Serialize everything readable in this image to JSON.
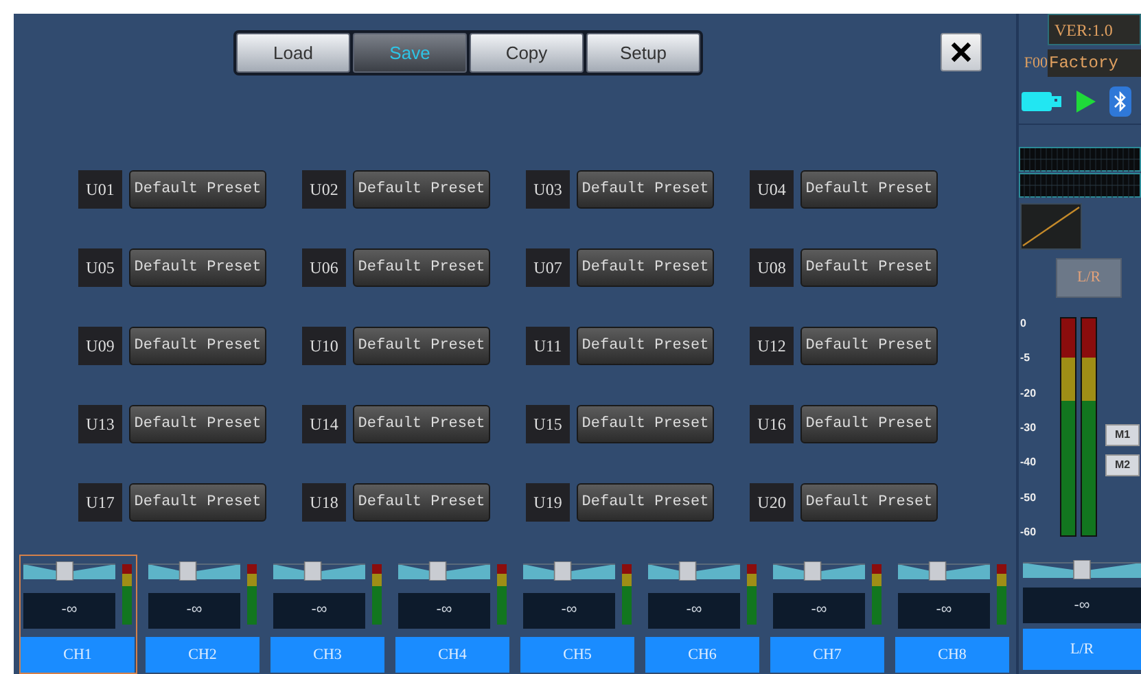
{
  "tabs": [
    {
      "label": "Load",
      "selected": false
    },
    {
      "label": "Save",
      "selected": true
    },
    {
      "label": "Copy",
      "selected": false
    },
    {
      "label": "Setup",
      "selected": false
    }
  ],
  "presets": [
    {
      "slot": "U01",
      "name": "Default Preset"
    },
    {
      "slot": "U02",
      "name": "Default Preset"
    },
    {
      "slot": "U03",
      "name": "Default Preset"
    },
    {
      "slot": "U04",
      "name": "Default Preset"
    },
    {
      "slot": "U05",
      "name": "Default Preset"
    },
    {
      "slot": "U06",
      "name": "Default Preset"
    },
    {
      "slot": "U07",
      "name": "Default Preset"
    },
    {
      "slot": "U08",
      "name": "Default Preset"
    },
    {
      "slot": "U09",
      "name": "Default Preset"
    },
    {
      "slot": "U10",
      "name": "Default Preset"
    },
    {
      "slot": "U11",
      "name": "Default Preset"
    },
    {
      "slot": "U12",
      "name": "Default Preset"
    },
    {
      "slot": "U13",
      "name": "Default Preset"
    },
    {
      "slot": "U14",
      "name": "Default Preset"
    },
    {
      "slot": "U15",
      "name": "Default Preset"
    },
    {
      "slot": "U16",
      "name": "Default Preset"
    },
    {
      "slot": "U17",
      "name": "Default Preset"
    },
    {
      "slot": "U18",
      "name": "Default Preset"
    },
    {
      "slot": "U19",
      "name": "Default Preset"
    },
    {
      "slot": "U20",
      "name": "Default Preset"
    }
  ],
  "channels": [
    {
      "label": "CH1",
      "selected": true,
      "level": 0.45,
      "reading": "-∞"
    },
    {
      "label": "CH2",
      "selected": false,
      "level": 0.43,
      "reading": "-∞"
    },
    {
      "label": "CH3",
      "selected": false,
      "level": 0.43,
      "reading": "-∞"
    },
    {
      "label": "CH4",
      "selected": false,
      "level": 0.43,
      "reading": "-∞"
    },
    {
      "label": "CH5",
      "selected": false,
      "level": 0.43,
      "reading": "-∞"
    },
    {
      "label": "CH6",
      "selected": false,
      "level": 0.43,
      "reading": "-∞"
    },
    {
      "label": "CH7",
      "selected": false,
      "level": 0.43,
      "reading": "-∞"
    },
    {
      "label": "CH8",
      "selected": false,
      "level": 0.43,
      "reading": "-∞"
    }
  ],
  "side_panel": {
    "version": "VER:1.0",
    "preset_number": "F00",
    "preset_name": "Factory",
    "output_button": "L/R",
    "meter_scale": [
      "0",
      "-5",
      "-20",
      "-30",
      "-40",
      "-50",
      "-60"
    ],
    "mute_buttons": [
      "M1",
      "M2"
    ],
    "master": {
      "label": "L/R",
      "level": 0.5,
      "reading": "-∞"
    }
  }
}
